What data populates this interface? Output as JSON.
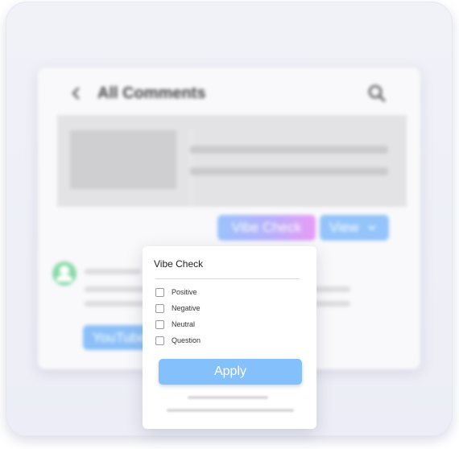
{
  "header": {
    "back_icon": "chevron-left-icon",
    "title": "All Comments",
    "search_icon": "search-icon"
  },
  "toolbar": {
    "vibe_check_label": "Vibe Check",
    "view_label": "View",
    "view_icon": "chevron-down-icon"
  },
  "comment": {
    "avatar_icon": "user-avatar-icon",
    "source_label": "YouTube"
  },
  "dropdown": {
    "title": "Vibe Check",
    "options": [
      {
        "label": "Positive",
        "checked": false
      },
      {
        "label": "Negative",
        "checked": false
      },
      {
        "label": "Neutral",
        "checked": false
      },
      {
        "label": "Question",
        "checked": false
      }
    ],
    "apply_label": "Apply"
  },
  "colors": {
    "accent_blue": "#84c0fb",
    "gradient_start": "#9cc3fb",
    "gradient_end": "#e89cf5",
    "avatar_green": "#8bdaa9"
  }
}
